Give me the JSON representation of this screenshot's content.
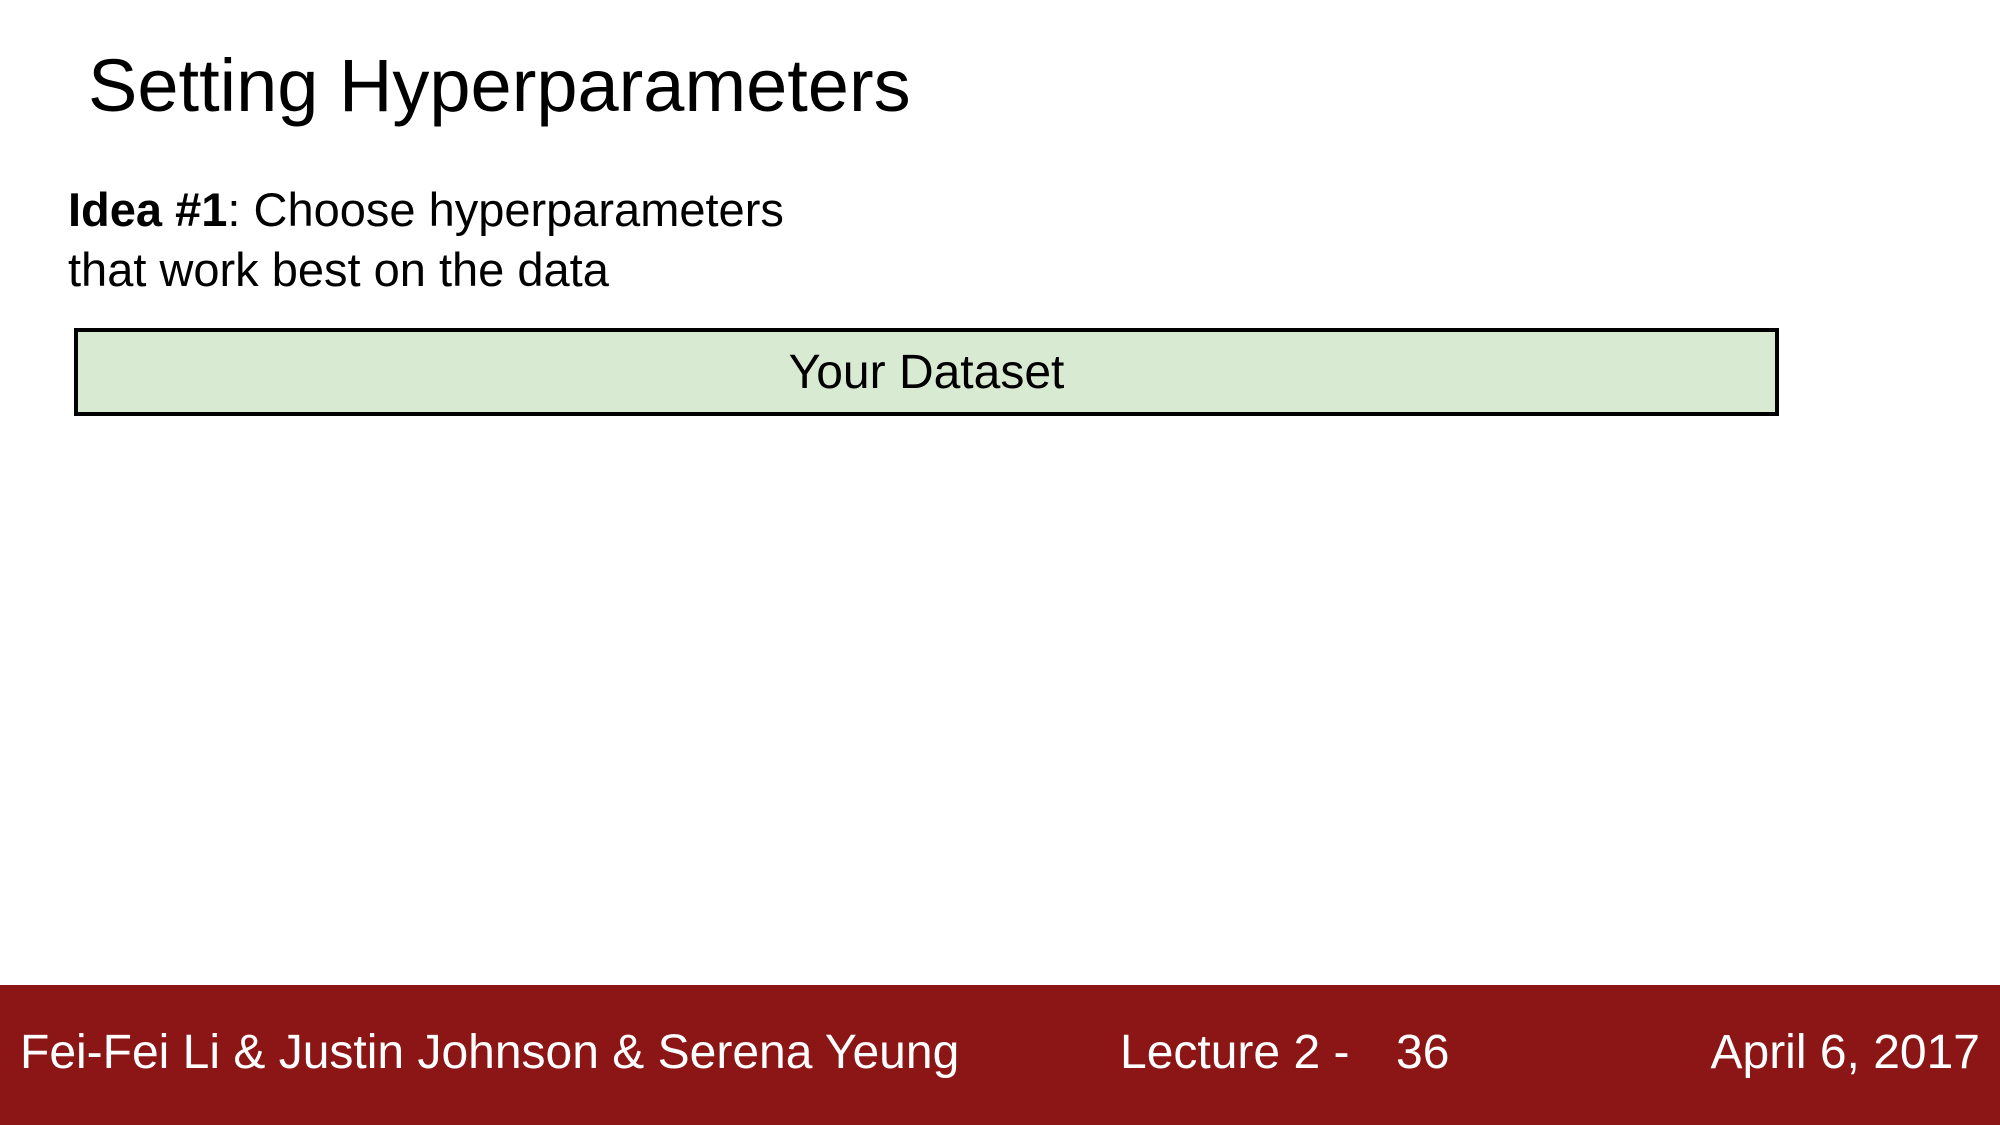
{
  "slide": {
    "title": "Setting Hyperparameters",
    "idea": {
      "label": "Idea #1",
      "text_line1": ": Choose hyperparameters",
      "text_line2": "that work best on the data"
    },
    "dataset_box": {
      "label": "Your Dataset",
      "fill_color": "#d9ead3"
    }
  },
  "footer": {
    "authors": "Fei-Fei Li & Justin Johnson & Serena Yeung",
    "lecture": "Lecture 2 -",
    "page": "36",
    "date": "April 6, 2017",
    "background_color": "#8c1515"
  }
}
